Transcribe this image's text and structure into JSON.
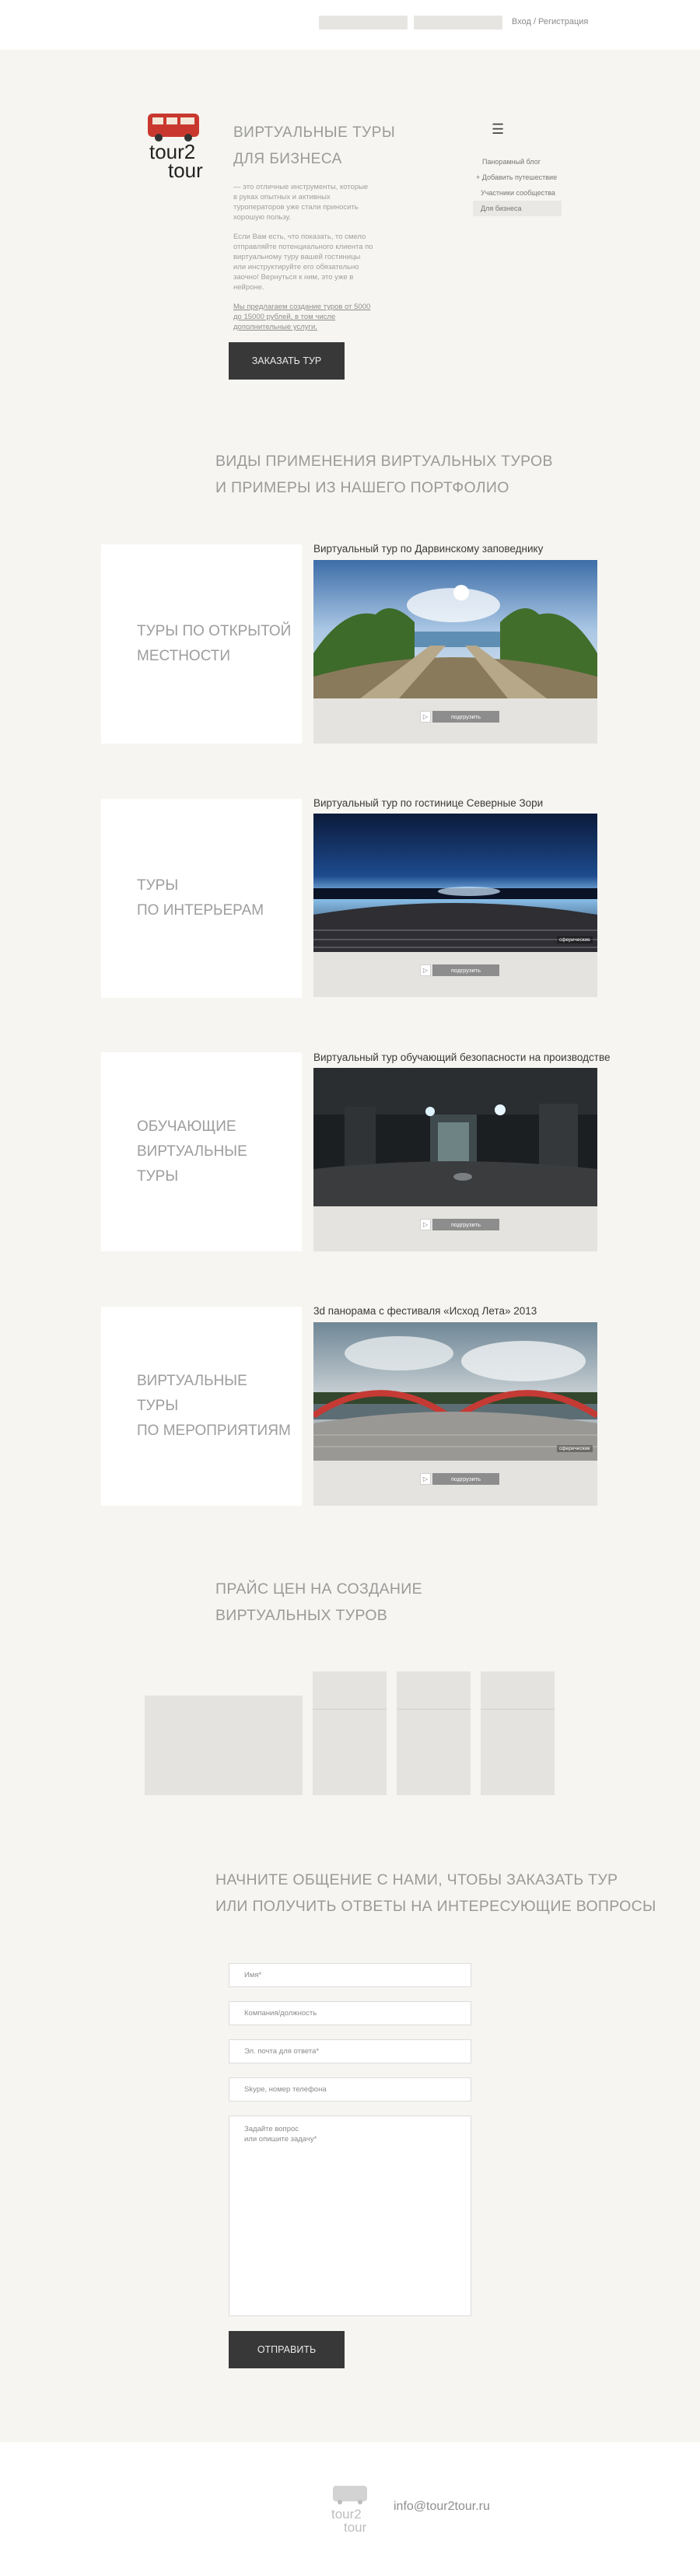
{
  "topbar": {
    "auth_text": "Вход / Регистрация"
  },
  "logo": {
    "text_top": "tour2",
    "text_bottom": "tour"
  },
  "hero": {
    "title_line1": "Виртуальные туры",
    "title_line2": "для бизнеса",
    "paragraph1": "— это отличные инструменты, которые в руках опытных и активных туроператоров уже стали приносить хорошую пользу.",
    "paragraph2": "Если Вам есть, что показать, то смело отправляйте потенциального клиента по виртуальному туру вашей гостиницы или инструктируйте его обязательно заочно! Вернуться к ним, это уже в нейроне.",
    "paragraph3": "Мы предлагаем создание туров от 5000 до 15000 рублей, в том числе дополнительные услуги.",
    "button": "Заказать тур"
  },
  "menu": {
    "items": [
      "Панорамный блог",
      "+ Добавить путешествие",
      "Участники сообщества",
      "Для бизнеса"
    ]
  },
  "portfolio": {
    "title_line1": "Виды применения виртуальных туров",
    "title_line2": "и примеры из нашего портфолио",
    "play_label": "▷",
    "load_label": "подгрузить",
    "categories": [
      {
        "label_line1": "Туры по открытой",
        "label_line2": "местности",
        "tour_title": "Виртуальный тур по Дарвинскому заповеднику"
      },
      {
        "label_line1": "Туры",
        "label_line2": "по интерьерам",
        "tour_title": "Виртуальный тур по гостинице Северные Зори"
      },
      {
        "label_line1": "Обучающие",
        "label_line2": "виртуальные туры",
        "tour_title": "Виртуальный тур обучающий безопасности на производстве"
      },
      {
        "label_line1": "Виртуальные туры",
        "label_line2": "по мероприятиям",
        "tour_title": "3d панорама с фестиваля «Исход Лета» 2013"
      }
    ],
    "watermark": "сферические"
  },
  "pricing": {
    "title_line1": "Прайс цен на создание",
    "title_line2": "виртуальных туров"
  },
  "contact": {
    "title_line1": "Начните общение с нами, чтобы заказать тур",
    "title_line2": "или получить ответы на интересующие вопросы",
    "name_placeholder": "Имя*",
    "company_placeholder": "Компания/должность",
    "email_placeholder": "Эл. почта для ответа*",
    "skype_placeholder": "Skype, номер телефона",
    "question_placeholder": "Задайте вопрос\nили опишите задачу*",
    "submit": "Отправить"
  },
  "footer": {
    "email": "info@tour2tour.ru",
    "logo_top": "tour2",
    "logo_bottom": "tour"
  },
  "colors": {
    "background": "#f6f5f1",
    "button": "#383838",
    "card": "#ffffff",
    "bar": "#e4e3df"
  }
}
